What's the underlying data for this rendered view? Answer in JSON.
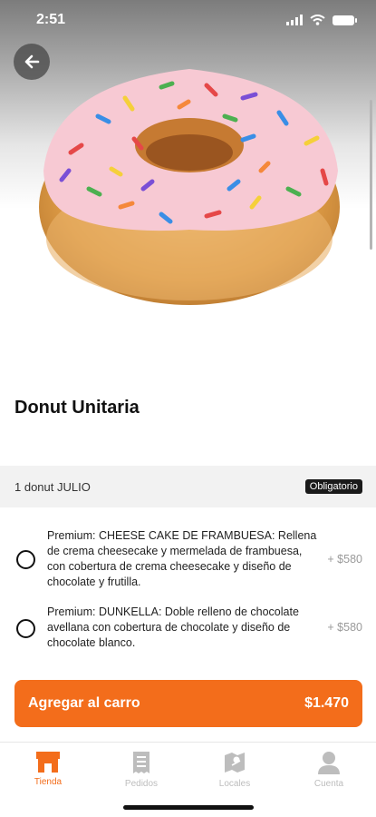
{
  "status_bar": {
    "time": "2:51"
  },
  "product": {
    "title": "Donut Unitaria",
    "image_icon": "sprinkle-donut-image"
  },
  "section": {
    "label": "1 donut JULIO",
    "badge": "Obligatorio"
  },
  "options": [
    {
      "text": "Premium: CHEESE CAKE DE FRAMBUESA: Rellena de crema cheesecake y mermelada de frambuesa, con cobertura de crema cheesecake y diseño de chocolate y frutilla.",
      "price": "+ $580",
      "selected": false
    },
    {
      "text": "Premium: DUNKELLA: Doble relleno de chocolate avellana con cobertura de chocolate y diseño de chocolate blanco.",
      "price": "+ $580",
      "selected": false
    }
  ],
  "cart_button": {
    "label": "Agregar al carro",
    "total": "$1.470"
  },
  "tabs": [
    {
      "label": "Tienda",
      "icon": "store-icon",
      "active": true
    },
    {
      "label": "Pedidos",
      "icon": "receipt-icon",
      "active": false
    },
    {
      "label": "Locales",
      "icon": "map-icon",
      "active": false
    },
    {
      "label": "Cuenta",
      "icon": "user-icon",
      "active": false
    }
  ],
  "colors": {
    "accent": "#f36d1b",
    "badge": "#1a1a1a",
    "inactive": "#bdbdbd"
  }
}
